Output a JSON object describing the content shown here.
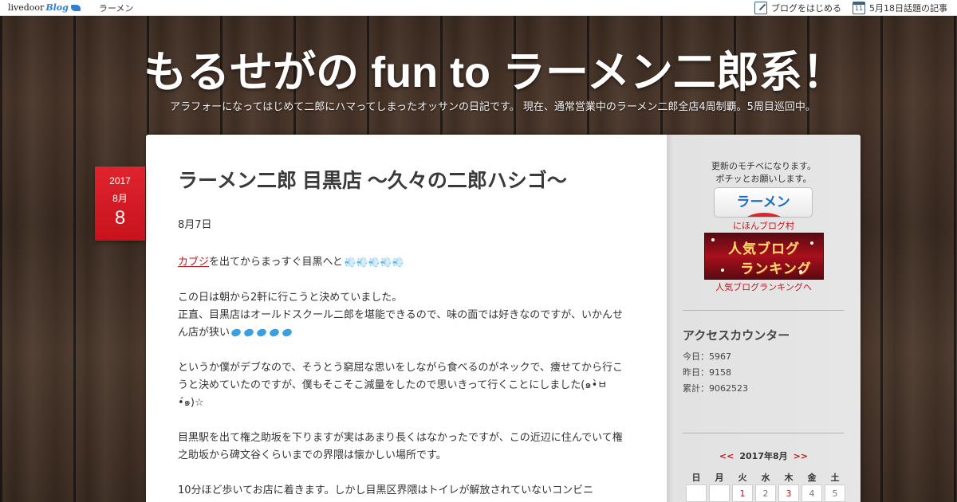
{
  "topbar": {
    "logo_text": "livedoor",
    "logo_blog": "Blog",
    "category": "ラーメン",
    "start_blog": "ブログをはじめる",
    "cal_day": "11",
    "topic_articles": "5月18日話題の記事"
  },
  "header": {
    "title": "もるせがの fun to ラーメン二郎系！",
    "description": "アラフォーになってはじめて二郎にハマってしまったオッサンの日記です。 現在、通常営業中のラーメン二郎全店4周制覇。5周目巡回中。"
  },
  "date_badge": {
    "year": "2017",
    "month": "8月",
    "day": "8"
  },
  "post": {
    "title": "ラーメン二郎 目黒店 〜久々の二郎ハシゴ〜",
    "date_line": "8月7日",
    "link_text": "カブジ",
    "para1_rest": "を出てからまっすぐ目黒へと",
    "para2_line1": "この日は朝から2軒に行こうと決めていました。",
    "para2_line2": "正直、目黒店はオールドスクール二郎を堪能できるので、味の面では好きなのですが、いかんせん店が狭い",
    "para3": "というか僕がデブなので、そうとう窮屈な思いをしながら食べるのがネックで、痩せてから行こうと決めていたのですが、僕もそこそこ減量をしたので思いきって行くことにしました(๑•̀ㅂ•́๑)☆",
    "para4": "目黒駅を出て権之助坂を下りますが実はあまり長くはなかったですが、この近辺に住んでいて権之助坂から碑文谷くらいまでの界隈は懐かしい場所です。",
    "para5": "10分ほど歩いてお店に着きます。しかし目黒区界隈はトイレが解放されていないコンビニ"
  },
  "sidebar": {
    "msg_line1": "更新のモチベになります。",
    "msg_line2": "ポチッとお願いします。",
    "ramen_button": "ラーメン",
    "nihon_label": "にほんブログ村",
    "rank_line1": "人気ブログ",
    "rank_line2": "ランキング",
    "rank_label": "人気ブログランキングへ",
    "access_heading": "アクセスカウンター",
    "today": "今日：5967",
    "yesterday": "昨日：9158",
    "total": "累計：9062523",
    "cal_prev": "<<",
    "cal_title": "2017年8月",
    "cal_next": ">>",
    "weekdays": [
      "日",
      "月",
      "火",
      "水",
      "木",
      "金",
      "土"
    ],
    "week1": [
      "",
      "",
      "1",
      "2",
      "3",
      "4",
      "5"
    ]
  },
  "colors": {
    "accent": "#c0151b",
    "badge": "#d61a24",
    "blog_blue": "#2e7fd0"
  }
}
